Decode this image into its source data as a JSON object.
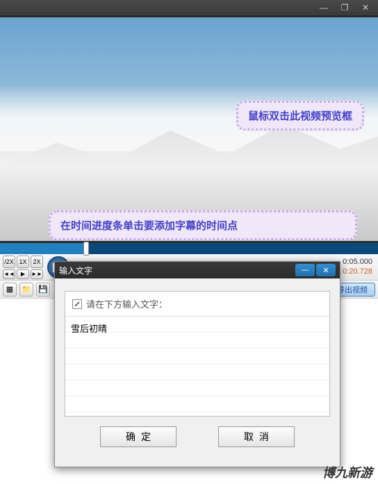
{
  "window": {
    "min": "—",
    "max": "❐",
    "close": "✕"
  },
  "callouts": {
    "preview": "鼠标双击此视频预览框",
    "timeline": "在时间进度条单击要添加字幕的时间点"
  },
  "speed": {
    "half": "/2X",
    "one": "1X",
    "two": "2X"
  },
  "nav": {
    "prev": "◄◄",
    "play": "▶",
    "next": "►►"
  },
  "playIcon": "❚❚",
  "timecode": {
    "current": "0:05.000",
    "total": "0:20.728"
  },
  "toolbar": {
    "new": "▦",
    "open": "📁",
    "save": "💾",
    "export": "导出视频"
  },
  "dialog": {
    "title": "输入文字",
    "min": "—",
    "close": "✕",
    "prompt": "请在下方输入文字：",
    "value": "雪后初晴",
    "ok": "确定",
    "cancel": "取消"
  },
  "watermark": "博九新游"
}
